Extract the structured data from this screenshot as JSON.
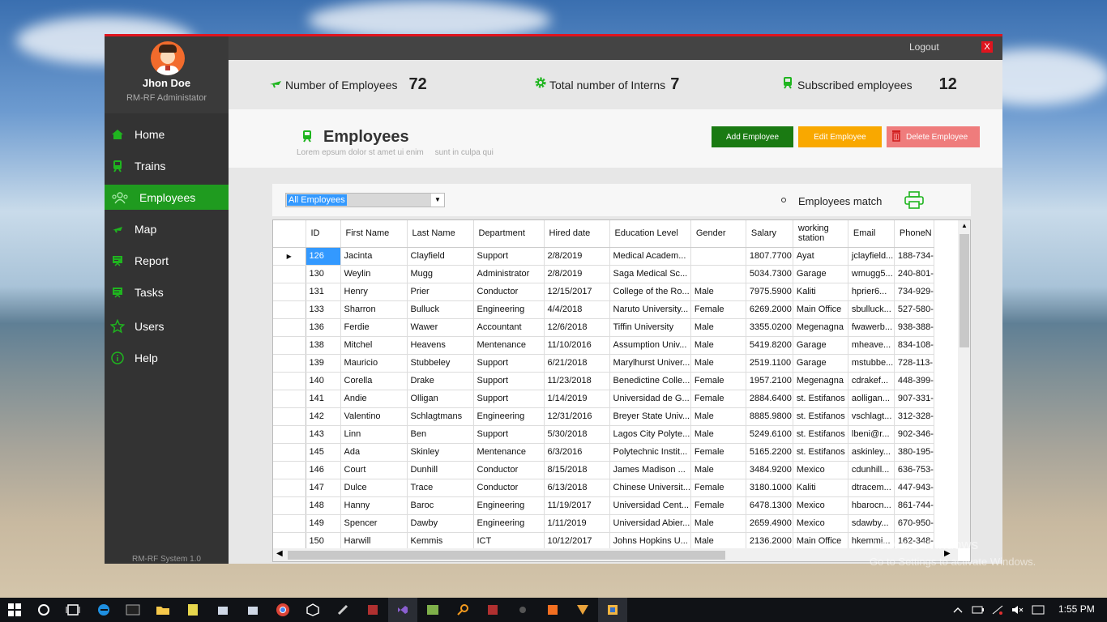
{
  "sidebar": {
    "user_name": "Jhon Doe",
    "user_role": "RM-RF Administator",
    "items": [
      {
        "label": "Home",
        "icon": "home-icon"
      },
      {
        "label": "Trains",
        "icon": "train-icon"
      },
      {
        "label": "Employees",
        "icon": "users-icon"
      },
      {
        "label": "Map",
        "icon": "map-icon"
      },
      {
        "label": "Report",
        "icon": "report-icon"
      },
      {
        "label": "Tasks",
        "icon": "tasks-icon"
      },
      {
        "label": "Users",
        "icon": "star-icon"
      },
      {
        "label": "Help",
        "icon": "info-icon"
      }
    ],
    "version": "RM-RF System  1.0"
  },
  "topbar": {
    "logout": "Logout",
    "close": "X"
  },
  "stats": [
    {
      "label": "Number of Employees",
      "value": "72",
      "icon": "plane-icon"
    },
    {
      "label": "Total number of Interns",
      "value": "7",
      "icon": "gear-icon"
    },
    {
      "label": "Subscribed employees",
      "value": "12",
      "icon": "train-icon"
    }
  ],
  "header": {
    "title": "Employees",
    "subtitle": "Lorem epsum dolor st amet ui enim     sunt in culpa qui",
    "add_label": "Add Employee",
    "edit_label": "Edit Employee",
    "delete_label": "Delete Employee"
  },
  "filter": {
    "selected": "All Employees",
    "match_label": "Employees match"
  },
  "colors": {
    "accent": "#1f9b1f",
    "add": "#1a7a12",
    "edit": "#f9a800",
    "delete": "#ef7c7c",
    "titlebar": "#e0141e"
  },
  "table": {
    "columns": [
      "ID",
      "First Name",
      "Last Name",
      "Department",
      "Hired date",
      "Education Level",
      "Gender",
      "Salary",
      "working station",
      "Email",
      "PhoneN"
    ],
    "rows": [
      [
        "126",
        "Jacinta",
        "Clayfield",
        "Support",
        "2/8/2019",
        "Medical Academ...",
        "",
        "1807.7700",
        "Ayat",
        "jclayfield...",
        "188-734-"
      ],
      [
        "130",
        "Weylin",
        "Mugg",
        "Administrator",
        "2/8/2019",
        "Saga Medical Sc...",
        "",
        "5034.7300",
        "Garage",
        "wmugg5...",
        "240-801-"
      ],
      [
        "131",
        "Henry",
        "Prier",
        "Conductor",
        "12/15/2017",
        "College of the Ro...",
        "Male",
        "7975.5900",
        "Kaliti",
        "hprier6...",
        "734-929-"
      ],
      [
        "133",
        "Sharron",
        "Bulluck",
        "Engineering",
        "4/4/2018",
        "Naruto University...",
        "Female",
        "6269.2000",
        "Main Office",
        "sbulluck...",
        "527-580-"
      ],
      [
        "136",
        "Ferdie",
        "Wawer",
        "Accountant",
        "12/6/2018",
        "Tiffin University",
        "Male",
        "3355.0200",
        "Megenagna",
        "fwawerb...",
        "938-388-"
      ],
      [
        "138",
        "Mitchel",
        "Heavens",
        "Mentenance",
        "11/10/2016",
        "Assumption Univ...",
        "Male",
        "5419.8200",
        "Garage",
        "mheave...",
        "834-108-"
      ],
      [
        "139",
        "Mauricio",
        "Stubbeley",
        "Support",
        "6/21/2018",
        "Marylhurst Univer...",
        "Male",
        "2519.1100",
        "Garage",
        "mstubbe...",
        "728-113-"
      ],
      [
        "140",
        "Corella",
        "Drake",
        "Support",
        "11/23/2018",
        "Benedictine Colle...",
        "Female",
        "1957.2100",
        "Megenagna",
        "cdrakef...",
        "448-399-"
      ],
      [
        "141",
        "Andie",
        "Olligan",
        "Support",
        "1/14/2019",
        "Universidad de G...",
        "Female",
        "2884.6400",
        "st. Estifanos",
        "aolligan...",
        "907-331-"
      ],
      [
        "142",
        "Valentino",
        "Schlagtmans",
        "Engineering",
        "12/31/2016",
        "Breyer State Univ...",
        "Male",
        "8885.9800",
        "st. Estifanos",
        "vschlagt...",
        "312-328-"
      ],
      [
        "143",
        "Linn",
        "Ben",
        "Support",
        "5/30/2018",
        "Lagos City Polyte...",
        "Male",
        "5249.6100",
        "st. Estifanos",
        "lbeni@r...",
        "902-346-"
      ],
      [
        "145",
        "Ada",
        "Skinley",
        "Mentenance",
        "6/3/2016",
        "Polytechnic Instit...",
        "Female",
        "5165.2200",
        "st. Estifanos",
        "askinley...",
        "380-195-"
      ],
      [
        "146",
        "Court",
        "Dunhill",
        "Conductor",
        "8/15/2018",
        "James Madison ...",
        "Male",
        "3484.9200",
        "Mexico",
        "cdunhill...",
        "636-753-"
      ],
      [
        "147",
        "Dulce",
        "Trace",
        "Conductor",
        "6/13/2018",
        "Chinese Universit...",
        "Female",
        "3180.1000",
        "Kaliti",
        "dtracem...",
        "447-943-"
      ],
      [
        "148",
        "Hanny",
        "Baroc",
        "Engineering",
        "11/19/2017",
        "Universidad Cent...",
        "Female",
        "6478.1300",
        "Mexico",
        "hbarocn...",
        "861-744-"
      ],
      [
        "149",
        "Spencer",
        "Dawby",
        "Engineering",
        "1/11/2019",
        "Universidad Abier...",
        "Male",
        "2659.4900",
        "Mexico",
        "sdawby...",
        "670-950-"
      ],
      [
        "150",
        "Harwill",
        "Kemmis",
        "ICT",
        "10/12/2017",
        "Johns Hopkins U...",
        "Male",
        "2136.2000",
        "Main Office",
        "hkemmi...",
        "162-348-"
      ]
    ]
  },
  "watermark": {
    "line1": "Activate Windows",
    "line2": "Go to Settings to activate Windows."
  },
  "taskbar": {
    "time": "1:55 PM"
  }
}
